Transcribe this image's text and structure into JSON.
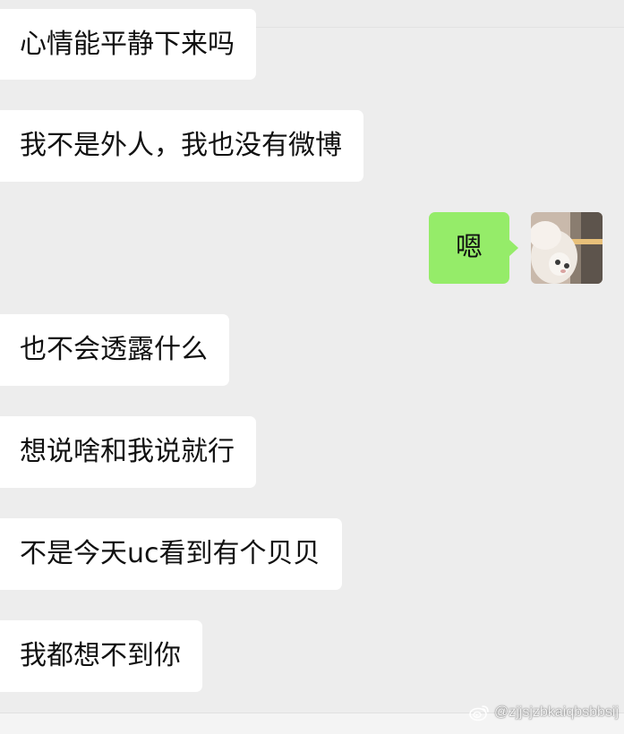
{
  "messages": [
    {
      "side": "left",
      "text": "心情能平静下来吗"
    },
    {
      "side": "left",
      "text": "我不是外人，我也没有微博"
    },
    {
      "side": "right",
      "text": "嗯"
    },
    {
      "side": "left",
      "text": "也不会透露什么"
    },
    {
      "side": "left",
      "text": "想说啥和我说就行"
    },
    {
      "side": "left",
      "text": "不是今天uc看到有个贝贝"
    },
    {
      "side": "left",
      "text": "我都想不到你"
    }
  ],
  "colors": {
    "background": "#ededed",
    "incoming_bubble": "#ffffff",
    "outgoing_bubble": "#95ec69"
  },
  "watermark": {
    "handle": "@zjjsjzbkaiqbsbbsij",
    "icon": "weibo-icon"
  }
}
